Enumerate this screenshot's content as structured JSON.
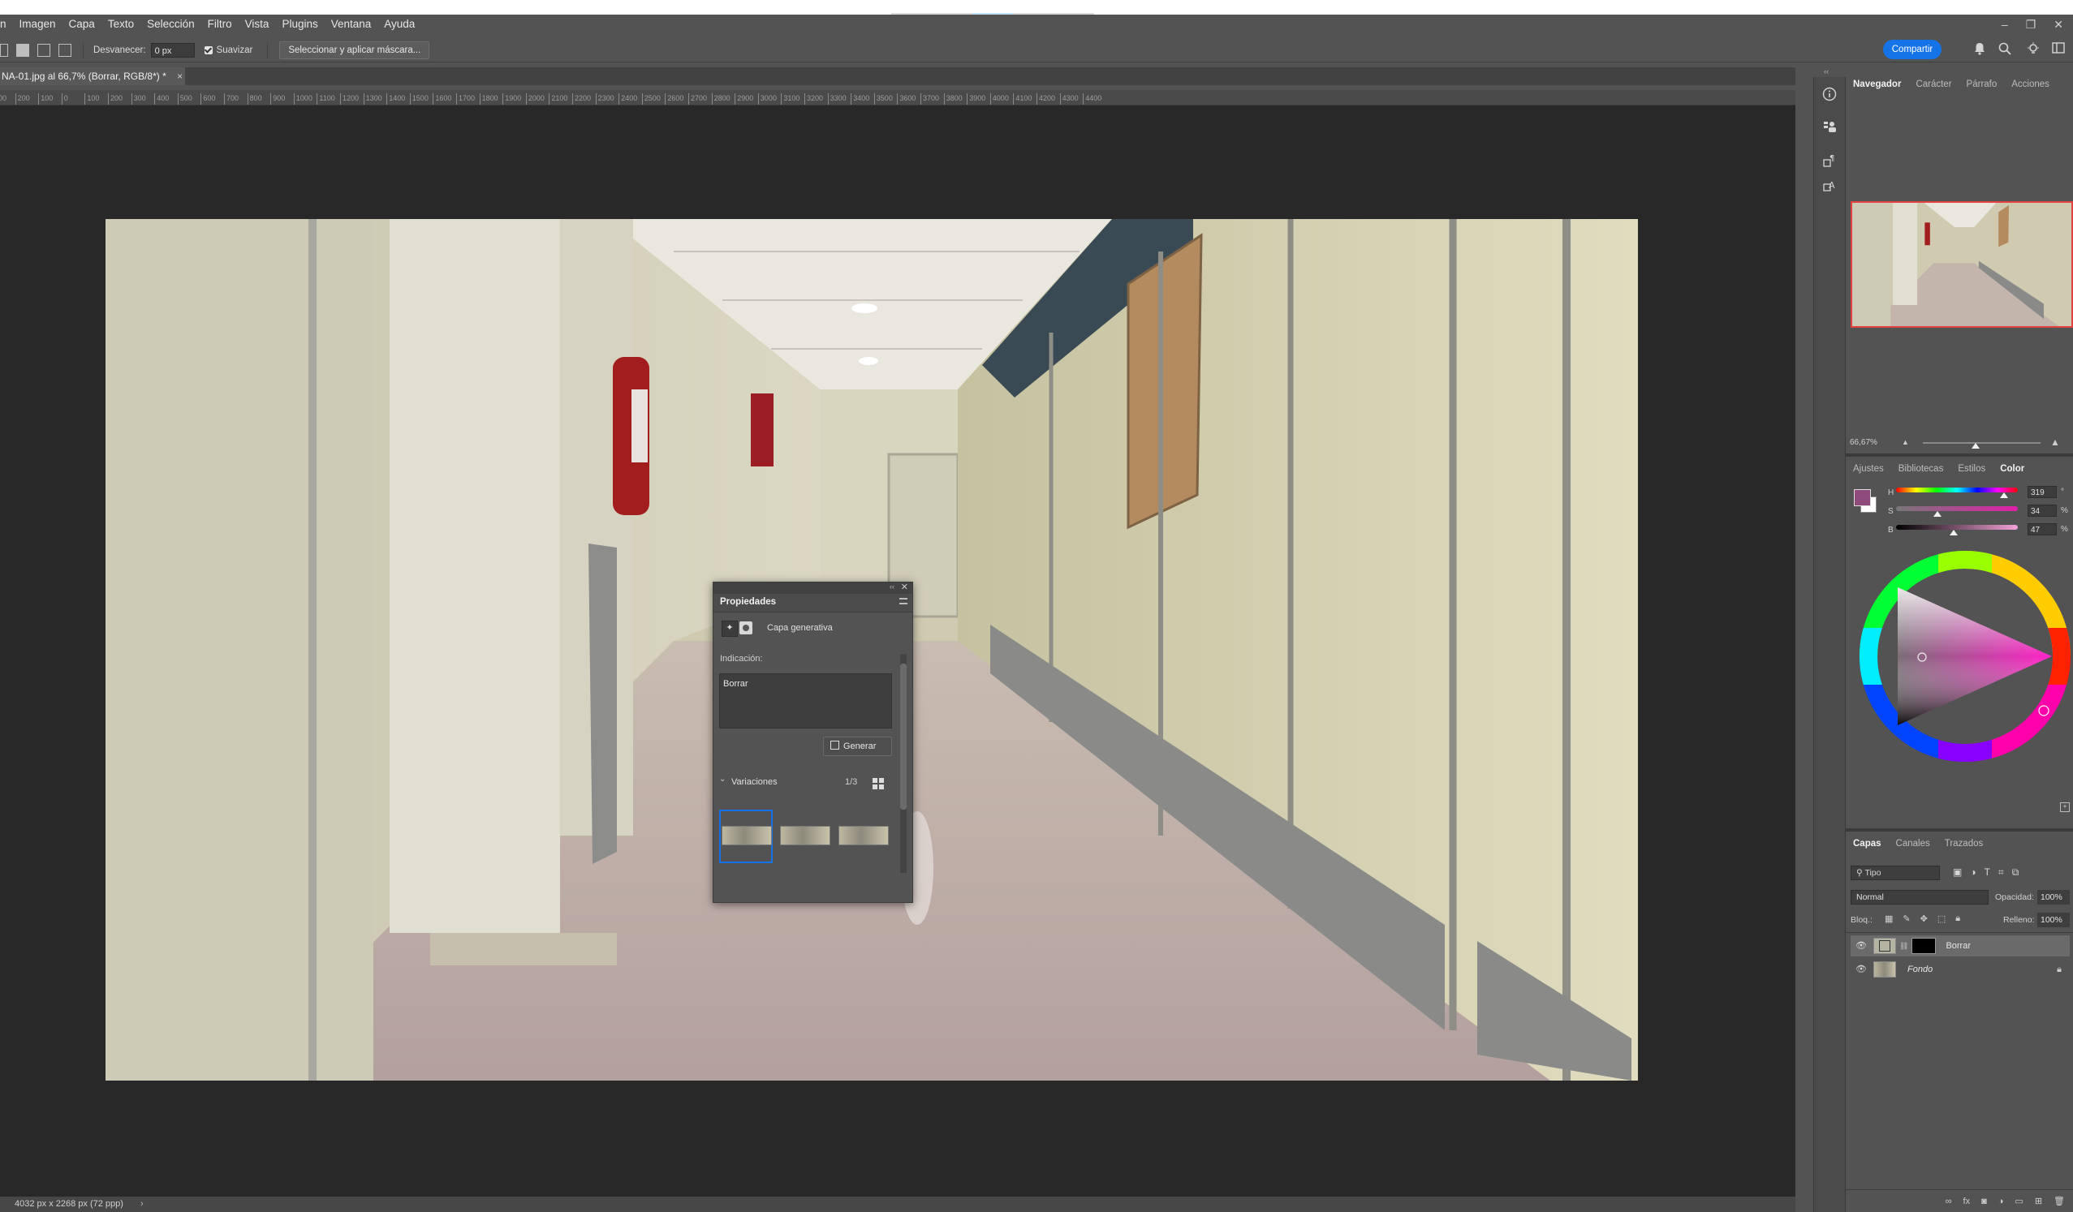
{
  "app": {
    "menu": [
      "n",
      "Imagen",
      "Capa",
      "Texto",
      "Selección",
      "Filtro",
      "Vista",
      "Plugins",
      "Ventana",
      "Ayuda"
    ],
    "window_controls": {
      "minimize": "–",
      "restore": "❐",
      "close": "✕"
    }
  },
  "options_bar": {
    "feather_label": "Desvanecer:",
    "feather_value": "0 px",
    "antialias_label": "Suavizar",
    "select_mask_label": "Seleccionar y aplicar máscara...",
    "share_label": "Compartir"
  },
  "document": {
    "tab_title": "NA-01.jpg al 66,7% (Borrar, RGB/8*) *",
    "tab_close": "×",
    "status_text": "4032 px x 2268 px (72 ppp)",
    "status_arrow": "›",
    "ruler_ticks": [
      "300",
      "200",
      "100",
      "0",
      "100",
      "200",
      "300",
      "400",
      "500",
      "600",
      "700",
      "800",
      "900",
      "1000",
      "1100",
      "1200",
      "1300",
      "1400",
      "1500",
      "1600",
      "1700",
      "1800",
      "1900",
      "2000",
      "2100",
      "2200",
      "2300",
      "2400",
      "2500",
      "2600",
      "2700",
      "2800",
      "2900",
      "3000",
      "3100",
      "3200",
      "3300",
      "3400",
      "3500",
      "3600",
      "3700",
      "3800",
      "3900",
      "4000",
      "4100",
      "4200",
      "4300",
      "4400"
    ]
  },
  "properties_panel": {
    "title": "Propiedades",
    "layer_type": "Capa generativa",
    "prompt_label": "Indicación:",
    "prompt_value": "Borrar",
    "generate_label": "Generar",
    "variations_label": "Variaciones",
    "variations_count": "1/3",
    "selected_variation": 1
  },
  "navigator": {
    "tabs": [
      "Navegador",
      "Carácter",
      "Párrafo",
      "Acciones"
    ],
    "active_tab": "Navegador",
    "zoom": "66,67%",
    "zoom_level": 0.45
  },
  "color_panel": {
    "tabs": [
      "Ajustes",
      "Bibliotecas",
      "Estilos",
      "Color"
    ],
    "active_tab": "Color",
    "foreground": "#8e4a7a",
    "sliders": [
      {
        "label": "H",
        "value": "319",
        "unit": "°",
        "fraction": 0.886
      },
      {
        "label": "S",
        "value": "34",
        "unit": "%",
        "fraction": 0.34
      },
      {
        "label": "B",
        "value": "47",
        "unit": "%",
        "fraction": 0.47
      }
    ]
  },
  "layers_panel": {
    "tabs": [
      "Capas",
      "Canales",
      "Trazados"
    ],
    "active_tab": "Capas",
    "filter_placeholder": "Tipo",
    "blend_mode": "Normal",
    "opacity_label": "Opacidad:",
    "opacity_value": "100%",
    "lock_label": "Bloq.:",
    "fill_label": "Relleno:",
    "fill_value": "100%",
    "layers": [
      {
        "name": "Borrar",
        "selected": true
      },
      {
        "name": "Fondo",
        "selected": false,
        "locked": true
      }
    ]
  },
  "colors": {
    "accent_blue": "#1473e6",
    "navigator_frame": "#e0423f"
  }
}
